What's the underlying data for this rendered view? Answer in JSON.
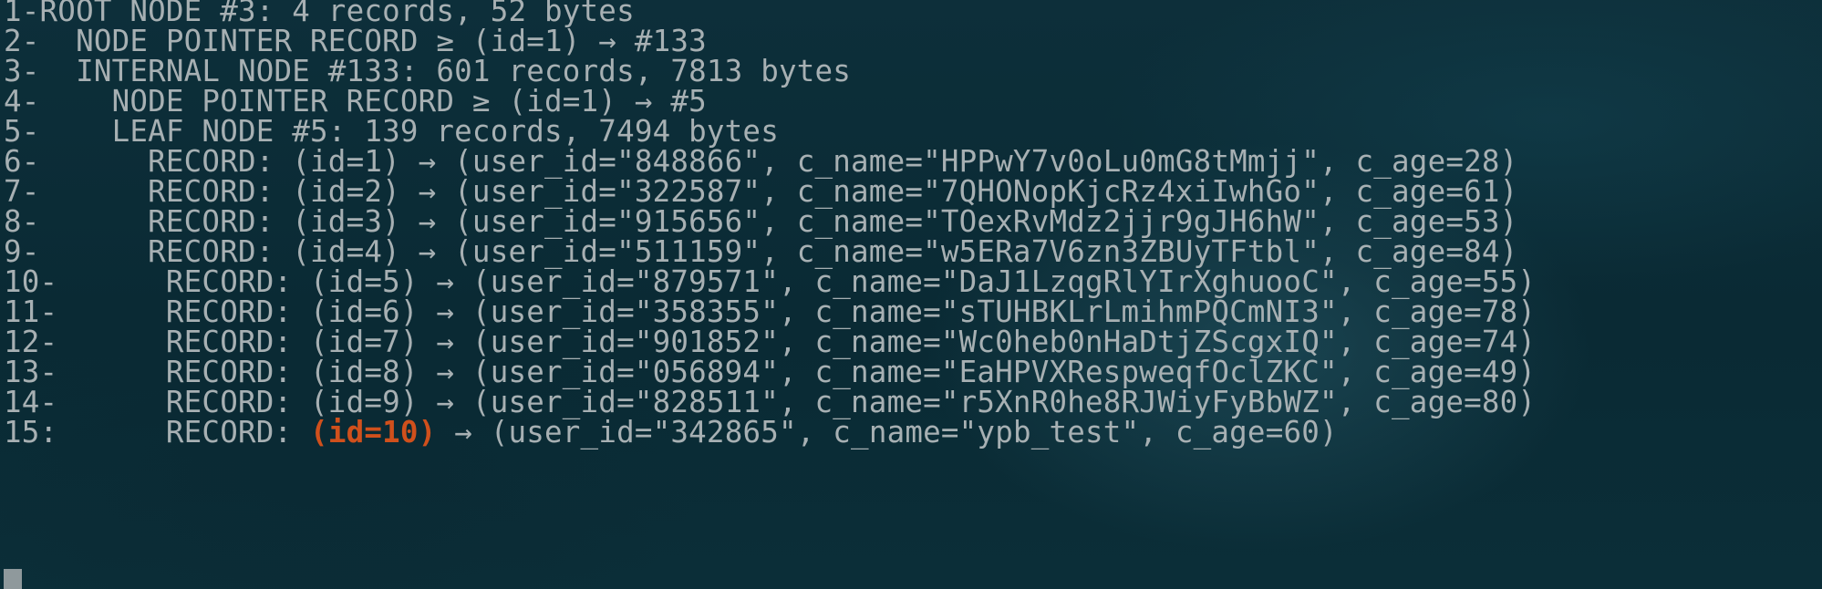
{
  "terminal": {
    "lines": [
      "1-ROOT NODE #3: 4 records, 52 bytes",
      "2-  NODE POINTER RECORD ≥ (id=1) → #133",
      "3-  INTERNAL NODE #133: 601 records, 7813 bytes",
      "4-    NODE POINTER RECORD ≥ (id=1) → #5",
      "5-    LEAF NODE #5: 139 records, 7494 bytes",
      "6-      RECORD: (id=1) → (user_id=\"848866\", c_name=\"HPPwY7v0oLu0mG8tMmjj\", c_age=28)",
      "7-      RECORD: (id=2) → (user_id=\"322587\", c_name=\"7QHONopKjcRz4xiIwhGo\", c_age=61)",
      "8-      RECORD: (id=3) → (user_id=\"915656\", c_name=\"TOexRvMdz2jjr9gJH6hW\", c_age=53)",
      "9-      RECORD: (id=4) → (user_id=\"511159\", c_name=\"w5ERa7V6zn3ZBUyTFtbl\", c_age=84)",
      "10-      RECORD: (id=5) → (user_id=\"879571\", c_name=\"DaJ1LzqgRlYIrXghuooC\", c_age=55)",
      "11-      RECORD: (id=6) → (user_id=\"358355\", c_name=\"sTUHBKLrLmihmPQCmNI3\", c_age=78)",
      "12-      RECORD: (id=7) → (user_id=\"901852\", c_name=\"Wc0heb0nHaDtjZScgxIQ\", c_age=74)",
      "13-      RECORD: (id=8) → (user_id=\"056894\", c_name=\"EaHPVXRespweqfOclZKC\", c_age=49)",
      "14-      RECORD: (id=9) → (user_id=\"828511\", c_name=\"r5XnR0he8RJWiyFyBbWZ\", c_age=80)"
    ],
    "last_line": {
      "prefix": "15:      RECORD: ",
      "match": "(id=10)",
      "suffix": " → (user_id=\"342865\", c_name=\"ypb_test\", c_age=60)"
    },
    "colors": {
      "background": "#0c2c37",
      "text": "#a7b0b3",
      "match_highlight": "#d0501c",
      "cursor": "#8f999c"
    }
  }
}
